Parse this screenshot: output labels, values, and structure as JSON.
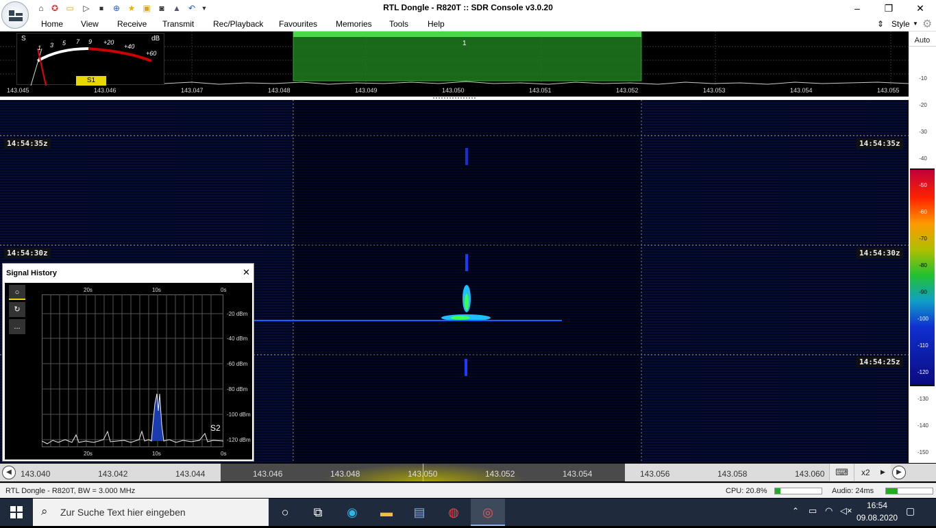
{
  "window": {
    "title": "RTL Dongle - R820T :: SDR Console v3.0.20"
  },
  "menu": [
    "Home",
    "View",
    "Receive",
    "Transmit",
    "Rec/Playback",
    "Favourites",
    "Memories",
    "Tools",
    "Help"
  ],
  "style_label": "Style",
  "auto_label": "Auto",
  "smeter": {
    "s_label": "S",
    "db_label": "dB",
    "scale_s": [
      "1",
      "3",
      "5",
      "7",
      "9"
    ],
    "scale_db": [
      "+20",
      "+40",
      "+60"
    ],
    "reading": "S1"
  },
  "vfo": {
    "number": "1"
  },
  "spectrum_freqs": [
    "143.045",
    "143.046",
    "143.047",
    "143.048",
    "143.049",
    "143.050",
    "143.051",
    "143.052",
    "143.053",
    "143.054",
    "143.055"
  ],
  "db_scale": [
    "-10",
    "-20",
    "-30",
    "-40",
    "-50",
    "-60",
    "-70",
    "-80",
    "-90",
    "-100",
    "-110",
    "-120",
    "-130",
    "-140",
    "-150"
  ],
  "timestamps": [
    "14:54:35z",
    "14:54:30z",
    "14:54:25z"
  ],
  "signal_history": {
    "title": "Signal History",
    "top_labels": [
      "20s",
      "10s",
      "0s"
    ],
    "bottom_labels": [
      "20s",
      "10s",
      "0s"
    ],
    "db_labels": [
      "-20 dBm",
      "-40 dBm",
      "-60 dBm",
      "-80 dBm",
      "-100 dBm",
      "-120 dBm"
    ],
    "s_reading": "S2",
    "tool_more": "..."
  },
  "bottom_freqs": [
    "143.040",
    "143.042",
    "143.044",
    "143.046",
    "143.048",
    "143.050",
    "143.052",
    "143.054",
    "143.056",
    "143.058",
    "143.060"
  ],
  "zoom": "x2",
  "status": {
    "device": "RTL Dongle - R820T, BW = 3.000 MHz",
    "cpu": "CPU: 20.8%",
    "audio": "Audio: 24ms",
    "cpu_level": 0.12,
    "audio_level": 0.25
  },
  "taskbar": {
    "search_placeholder": "Zur Suche Text hier eingeben",
    "time": "16:54",
    "date": "09.08.2020"
  }
}
